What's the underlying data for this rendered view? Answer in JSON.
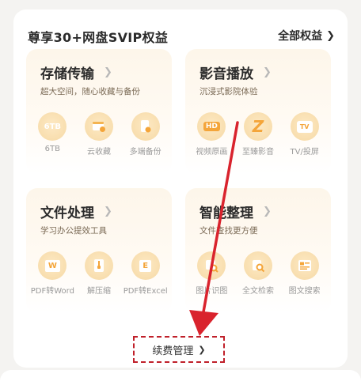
{
  "header": {
    "title": "尊享30+网盘SVIP权益",
    "all_rights": "全部权益"
  },
  "cards": [
    {
      "title": "存储传输",
      "subtitle": "超大空间，随心收藏与备份",
      "features": [
        {
          "icon": "6tb-icon",
          "icon_text": "6TB",
          "label": "6TB"
        },
        {
          "icon": "cloud-collect-icon",
          "label": "云收藏"
        },
        {
          "icon": "multi-backup-icon",
          "label": "多端备份"
        }
      ]
    },
    {
      "title": "影音播放",
      "subtitle": "沉浸式影院体验",
      "features": [
        {
          "icon": "hd-icon",
          "icon_text": "HD",
          "label": "视频原画"
        },
        {
          "icon": "premium-audio-icon",
          "icon_text": "Z",
          "label": "至臻影音"
        },
        {
          "icon": "tv-icon",
          "icon_text": "TV",
          "label": "TV/投屏"
        }
      ]
    },
    {
      "title": "文件处理",
      "subtitle": "学习办公提效工具",
      "features": [
        {
          "icon": "pdf-to-word-icon",
          "icon_text": "W",
          "label": "PDF转Word"
        },
        {
          "icon": "unzip-icon",
          "label": "解压缩"
        },
        {
          "icon": "pdf-to-excel-icon",
          "icon_text": "E",
          "label": "PDF转Excel"
        }
      ]
    },
    {
      "title": "智能整理",
      "subtitle": "文件查找更方便",
      "features": [
        {
          "icon": "image-recognition-icon",
          "label": "图片识图"
        },
        {
          "icon": "fulltext-search-icon",
          "label": "全文检索"
        },
        {
          "icon": "image-text-search-icon",
          "label": "图文搜索"
        }
      ]
    }
  ],
  "renew": {
    "label": "续费管理"
  },
  "colors": {
    "accent": "#e8a23a",
    "icon_bg": "#f6d9a5",
    "highlight": "#d9232d"
  }
}
